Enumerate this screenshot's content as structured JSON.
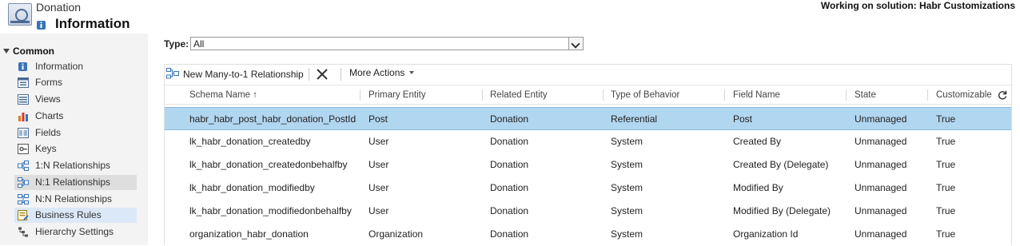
{
  "header": {
    "entity_name": "Donation",
    "page_title": "Information",
    "solution_label": "Working on solution: Habr Customizations"
  },
  "sidebar": {
    "section": "Common",
    "items": [
      {
        "label": "Information",
        "icon": "information-icon"
      },
      {
        "label": "Forms",
        "icon": "forms-icon"
      },
      {
        "label": "Views",
        "icon": "views-icon"
      },
      {
        "label": "Charts",
        "icon": "charts-icon"
      },
      {
        "label": "Fields",
        "icon": "fields-icon"
      },
      {
        "label": "Keys",
        "icon": "keys-icon"
      },
      {
        "label": "1:N Relationships",
        "icon": "relationship-1n-icon"
      },
      {
        "label": "N:1 Relationships",
        "icon": "relationship-n1-icon"
      },
      {
        "label": "N:N Relationships",
        "icon": "relationship-nn-icon"
      },
      {
        "label": "Business Rules",
        "icon": "business-rules-icon"
      },
      {
        "label": "Hierarchy Settings",
        "icon": "hierarchy-icon"
      }
    ],
    "active_item": "N:1 Relationships",
    "hover_item": "Business Rules"
  },
  "filter": {
    "type_label": "Type:",
    "type_value": "All"
  },
  "toolbar": {
    "new_label": "New Many-to-1 Relationship",
    "more_label": "More Actions"
  },
  "grid": {
    "columns": [
      "Schema Name ↑",
      "Primary Entity",
      "Related Entity",
      "Type of Behavior",
      "Field Name",
      "State",
      "Customizable"
    ],
    "rows": [
      [
        "habr_habr_post_habr_donation_PostId",
        "Post",
        "Donation",
        "Referential",
        "Post",
        "Unmanaged",
        "True"
      ],
      [
        "lk_habr_donation_createdby",
        "User",
        "Donation",
        "System",
        "Created By",
        "Unmanaged",
        "True"
      ],
      [
        "lk_habr_donation_createdonbehalfby",
        "User",
        "Donation",
        "System",
        "Created By (Delegate)",
        "Unmanaged",
        "True"
      ],
      [
        "lk_habr_donation_modifiedby",
        "User",
        "Donation",
        "System",
        "Modified By",
        "Unmanaged",
        "True"
      ],
      [
        "lk_habr_donation_modifiedonbehalfby",
        "User",
        "Donation",
        "System",
        "Modified By (Delegate)",
        "Unmanaged",
        "True"
      ],
      [
        "organization_habr_donation",
        "Organization",
        "Donation",
        "System",
        "Organization Id",
        "Unmanaged",
        "True"
      ]
    ],
    "selected_row": 0
  },
  "colors": {
    "selected_row": "#b1d6f0",
    "sidebar_bg": "#f3f3f3",
    "accent_blue": "#2f6fb0"
  }
}
